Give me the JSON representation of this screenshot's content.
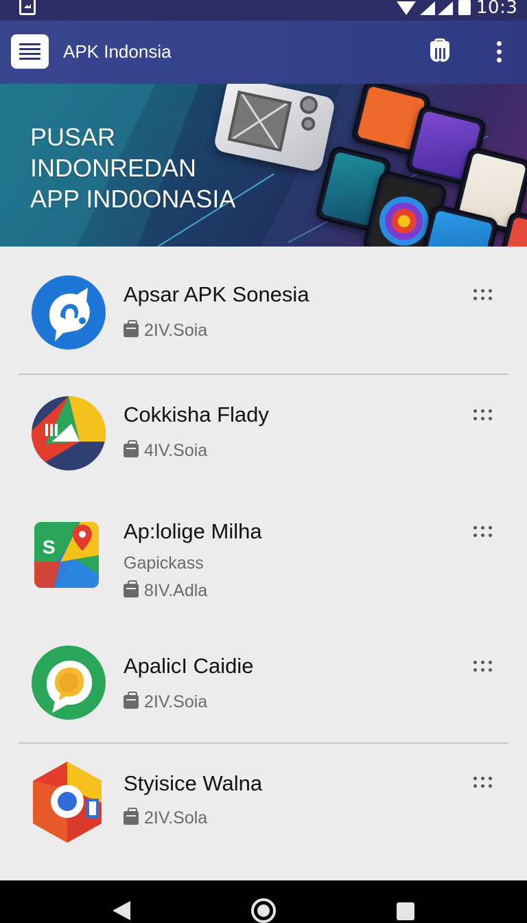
{
  "status_bar": {
    "time": "10:3"
  },
  "app_bar": {
    "title": "APK Indonsia"
  },
  "banner": {
    "lines": [
      "PUSAR",
      "INDONREDAN",
      "APP IND0ONASIA"
    ]
  },
  "apps": [
    {
      "name": "Apsar APK Sonesia",
      "subtitle": "",
      "meta": "2IV.Soia"
    },
    {
      "name": "Cokkisha Flady",
      "subtitle": "",
      "meta": "4IV.Soia"
    },
    {
      "name": "Ap:lolige Milha",
      "subtitle": "Gapickass",
      "meta": "8IV.Adla"
    },
    {
      "name": "ApalicI Caidie",
      "subtitle": "",
      "meta": "2IV.Soia"
    },
    {
      "name": "Styisice Walna",
      "subtitle": "",
      "meta": "2IV.Sola"
    }
  ]
}
